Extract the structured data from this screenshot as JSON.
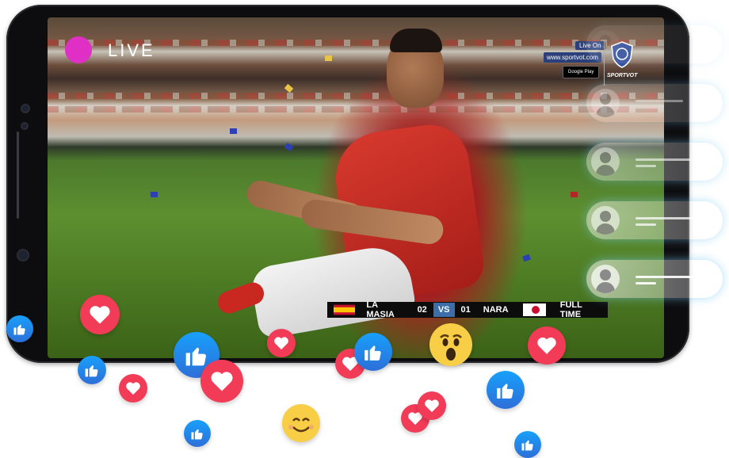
{
  "stream": {
    "live_label": "LIVE",
    "brand": {
      "live_on": "Live On",
      "url": "www.sportvot.com",
      "store_badge": "Google Play",
      "name": "SPORTVOT"
    }
  },
  "scoreboard": {
    "home_team": "LA MASIA",
    "home_score": "02",
    "vs": "VS",
    "away_score": "01",
    "away_team": "NARA",
    "status": "FULL TIME"
  },
  "comments_count": 5,
  "icons": {
    "live": "live-dot-icon",
    "like": "thumbs-up-icon",
    "heart": "heart-icon",
    "wow": "wow-emoji-icon",
    "smile": "smile-emoji-icon",
    "avatar": "user-avatar-icon"
  },
  "colors": {
    "live_dot": "#e02fc4",
    "heart": "#f23b57",
    "like": "#1877f2",
    "vs_badge": "#3e6ea8"
  }
}
